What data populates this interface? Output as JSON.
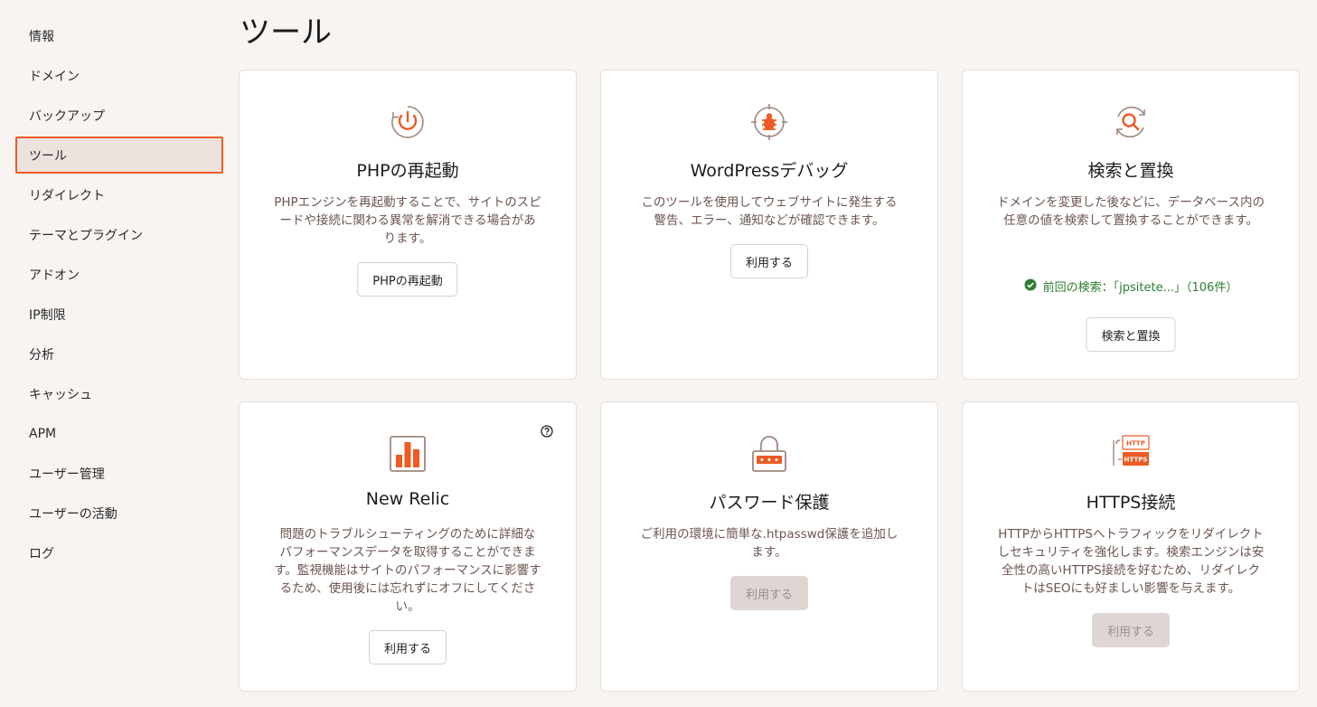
{
  "sidebar": {
    "items": [
      {
        "label": "情報"
      },
      {
        "label": "ドメイン"
      },
      {
        "label": "バックアップ"
      },
      {
        "label": "ツール",
        "active": true
      },
      {
        "label": "リダイレクト"
      },
      {
        "label": "テーマとプラグイン"
      },
      {
        "label": "アドオン"
      },
      {
        "label": "IP制限"
      },
      {
        "label": "分析"
      },
      {
        "label": "キャッシュ"
      },
      {
        "label": "APM"
      },
      {
        "label": "ユーザー管理"
      },
      {
        "label": "ユーザーの活動"
      },
      {
        "label": "ログ"
      }
    ]
  },
  "page": {
    "title": "ツール"
  },
  "colors": {
    "accent": "#ee5a24",
    "success": "#2e7d32",
    "icon_stroke": "#a0877e"
  },
  "cards": {
    "php": {
      "icon": "power-restart-icon",
      "title": "PHPの再起動",
      "description": "PHPエンジンを再起動することで、サイトのスピードや接続に関わる異常を解消できる場合があります。",
      "button": "PHPの再起動"
    },
    "wpdebug": {
      "icon": "bug-target-icon",
      "title": "WordPressデバッグ",
      "description": "このツールを使用してウェブサイトに発生する警告、エラー、通知などが確認できます。",
      "button": "利用する"
    },
    "search_replace": {
      "icon": "search-sync-icon",
      "title": "検索と置換",
      "description": "ドメインを変更した後などに、データベース内の任意の値を検索して置換することができます。",
      "status": "前回の検索：「jpsitete...」（106件）",
      "button": "検索と置換"
    },
    "newrelic": {
      "icon": "bar-chart-icon",
      "title": "New Relic",
      "description": "問題のトラブルシューティングのために詳細なパフォーマンスデータを取得することができます。監視機能はサイトのパフォーマンスに影響するため、使用後には忘れずにオフにしてください。",
      "button": "利用する"
    },
    "password": {
      "icon": "lock-password-icon",
      "title": "パスワード保護",
      "description": "ご利用の環境に簡単な.htpasswd保護を追加します。",
      "button": "利用する",
      "button_disabled": true
    },
    "https": {
      "icon": "http-https-icon",
      "icon_labels": [
        "HTTP",
        "HTTPS"
      ],
      "title": "HTTPS接続",
      "description": "HTTPからHTTPSへトラフィックをリダイレクトしセキュリティを強化します。検索エンジンは安全性の高いHTTPS接続を好むため、リダイレクトはSEOにも好ましい影響を与えます。",
      "button": "利用する",
      "button_disabled": true
    }
  }
}
